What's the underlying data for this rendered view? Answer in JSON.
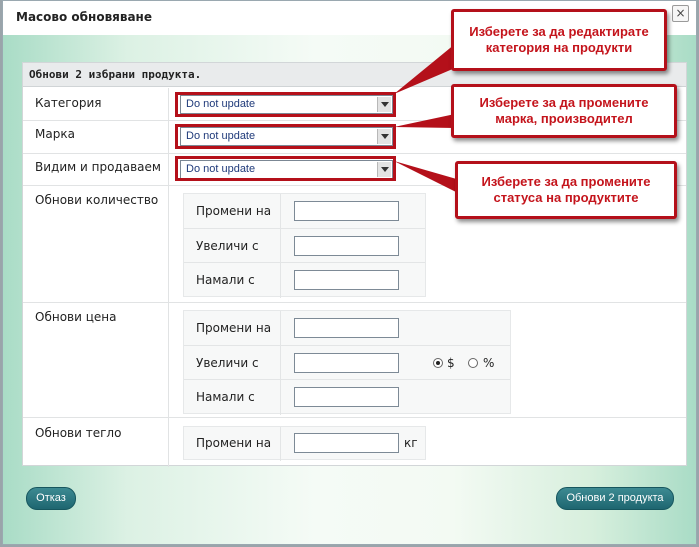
{
  "window": {
    "title": "Масово обновяване",
    "close_label": "×"
  },
  "panel": {
    "header": "Обнови 2 избрани продукта."
  },
  "fields": {
    "category": {
      "label": "Категория",
      "value": "Do not update"
    },
    "brand": {
      "label": "Марка",
      "value": "Do not update"
    },
    "visible": {
      "label": "Видим и продаваем",
      "value": "Do not update"
    }
  },
  "quantity": {
    "label": "Обнови количество",
    "set": "Промени на",
    "increase": "Увеличи с",
    "decrease": "Намали с"
  },
  "price": {
    "label": "Обнови цена",
    "set": "Промени на",
    "increase": "Увеличи с",
    "decrease": "Намали с",
    "mode_currency": "$",
    "mode_percent": "%",
    "selected_mode": "$"
  },
  "weight": {
    "label": "Обнови тегло",
    "set": "Промени на",
    "unit": "кг"
  },
  "buttons": {
    "cancel": "Отказ",
    "update": "Обнови 2 продукта"
  },
  "callouts": {
    "category": "Изберете за да редактирате категория на продукти",
    "brand": "Изберете за да промените марка, производител",
    "status": "Изберете за да промените статуса на продуктите"
  },
  "colors": {
    "accent": "#b4101a",
    "button": "#2a7780"
  }
}
